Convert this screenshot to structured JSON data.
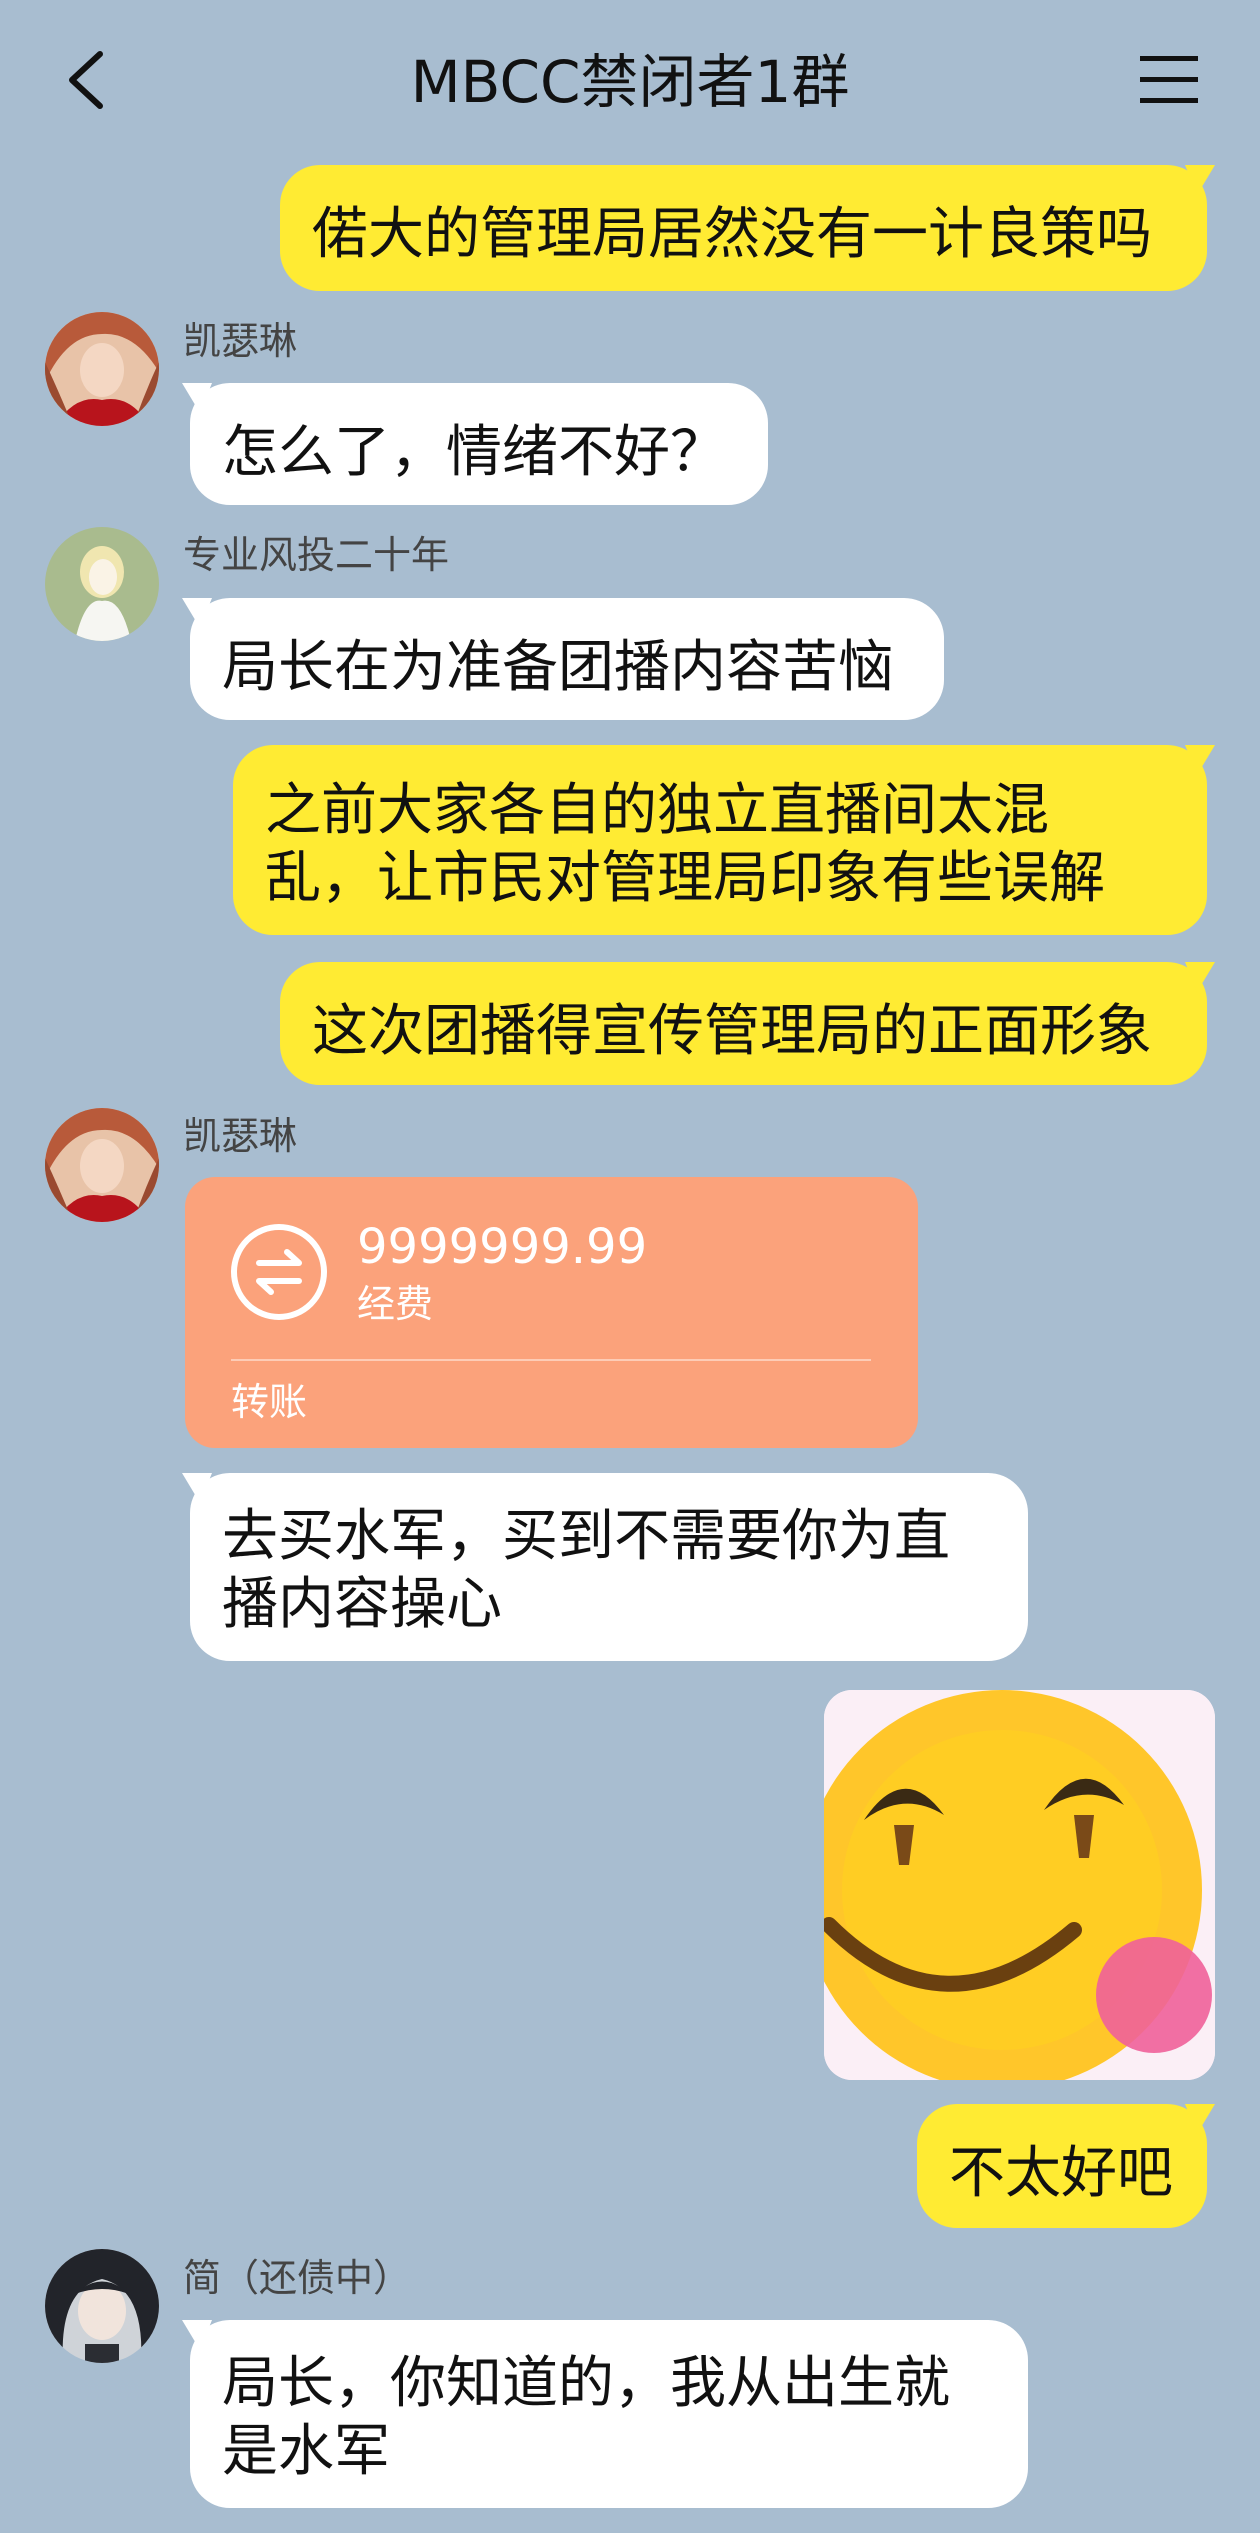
{
  "header": {
    "title": "MBCC禁闭者1群",
    "back_icon": "chevron-left-icon",
    "menu_icon": "hamburger-menu-icon"
  },
  "messages": [
    {
      "side": "me",
      "text": "偌大的管理局居然没有一计良策吗"
    },
    {
      "side": "other",
      "sender": "凯瑟琳",
      "text": "怎么了，情绪不好？"
    },
    {
      "side": "other",
      "sender": "专业风投二十年",
      "text": "局长在为准备团播内容苦恼"
    },
    {
      "side": "me",
      "lines": [
        "之前大家各自的独立直播间太混",
        "乱，让市民对管理局印象有些误解"
      ]
    },
    {
      "side": "me",
      "text": "这次团播得宣传管理局的正面形象"
    },
    {
      "side": "other",
      "sender": "凯瑟琳",
      "transfer": {
        "amount": "9999999.99",
        "note": "经费",
        "type": "转账",
        "icon": "transfer-arrows-icon"
      }
    },
    {
      "side": "other",
      "lines": [
        "去买水军，买到不需要你为直",
        "播内容操心"
      ]
    },
    {
      "side": "me",
      "sticker": "blushing-smiley-sticker"
    },
    {
      "side": "me",
      "text": "不太好吧"
    },
    {
      "side": "other",
      "sender": "简（还债中）",
      "lines": [
        "局长，你知道的，我从出生就",
        "是水军"
      ]
    }
  ],
  "colors": {
    "background": "#a8bdd0",
    "my_bubble": "#ffeb33",
    "other_bubble": "#ffffff",
    "transfer_card": "#fba27b"
  }
}
